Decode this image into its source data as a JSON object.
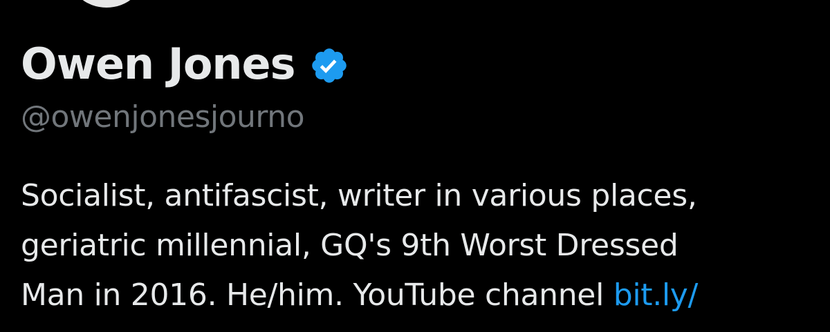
{
  "profile": {
    "display_name": "Owen Jones",
    "verified_icon": "verified-badge-icon",
    "handle": "@owenjonesjourno",
    "bio": {
      "line1": "Socialist, antifascist, writer in various places,",
      "line2": "geriatric millennial, GQ's 9th Worst Dressed",
      "line3_text": "Man in 2016. He/him. YouTube channel ",
      "line3_link": "bit.ly/"
    }
  },
  "colors": {
    "background": "#000000",
    "primary_text": "#e7e9ea",
    "secondary_text": "#71767b",
    "link": "#1d9bf0",
    "verified_badge": "#1d9bf0"
  }
}
